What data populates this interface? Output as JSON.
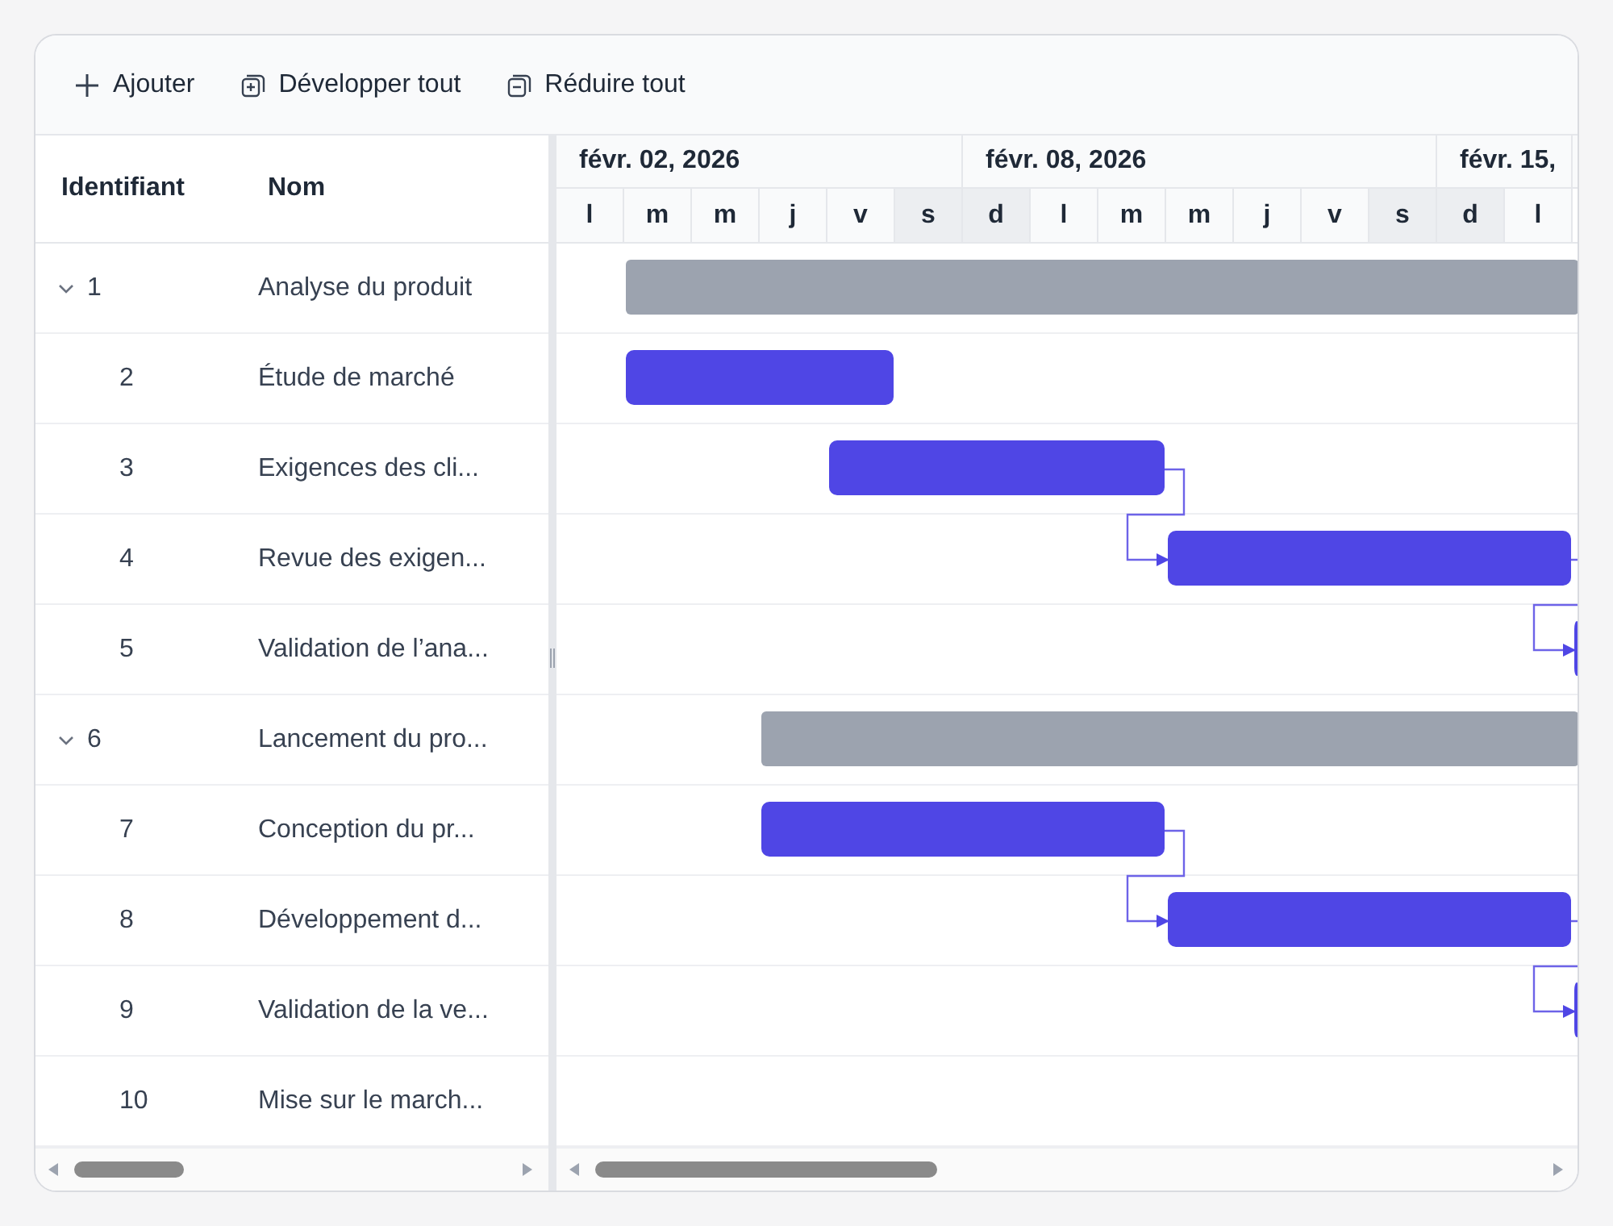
{
  "toolbar": [
    {
      "kind": "add",
      "label": "Ajouter"
    },
    {
      "kind": "expand",
      "label": "Développer tout"
    },
    {
      "kind": "collapse",
      "label": "Réduire tout"
    }
  ],
  "grid": {
    "columns": [
      "Identifiant",
      "Nom"
    ],
    "rows": [
      {
        "id": "1",
        "name": "Analyse du produit",
        "kind": "summary",
        "expanded": true
      },
      {
        "id": "2",
        "name": "Étude de marché",
        "kind": "task"
      },
      {
        "id": "3",
        "name": "Exigences des cli...",
        "kind": "task"
      },
      {
        "id": "4",
        "name": "Revue des exigen...",
        "kind": "task"
      },
      {
        "id": "5",
        "name": "Validation de l’ana...",
        "kind": "task"
      },
      {
        "id": "6",
        "name": "Lancement du pro...",
        "kind": "summary",
        "expanded": true
      },
      {
        "id": "7",
        "name": "Conception du pr...",
        "kind": "task"
      },
      {
        "id": "8",
        "name": "Développement d...",
        "kind": "task"
      },
      {
        "id": "9",
        "name": "Validation de la ve...",
        "kind": "task"
      },
      {
        "id": "10",
        "name": "Mise sur le march...",
        "kind": "none"
      }
    ]
  },
  "timeline": {
    "weeks": [
      "févr. 02, 2026",
      "févr. 08, 2026",
      "févr. 15,"
    ],
    "days": [
      {
        "label": "l",
        "weekend": false
      },
      {
        "label": "m",
        "weekend": false
      },
      {
        "label": "m",
        "weekend": false
      },
      {
        "label": "j",
        "weekend": false
      },
      {
        "label": "v",
        "weekend": false
      },
      {
        "label": "s",
        "weekend": true
      },
      {
        "label": "d",
        "weekend": true
      },
      {
        "label": "l",
        "weekend": false
      },
      {
        "label": "m",
        "weekend": false
      },
      {
        "label": "m",
        "weekend": false
      },
      {
        "label": "j",
        "weekend": false
      },
      {
        "label": "v",
        "weekend": false
      },
      {
        "label": "s",
        "weekend": true
      },
      {
        "label": "d",
        "weekend": true
      },
      {
        "label": "l",
        "weekend": false
      }
    ]
  }
}
